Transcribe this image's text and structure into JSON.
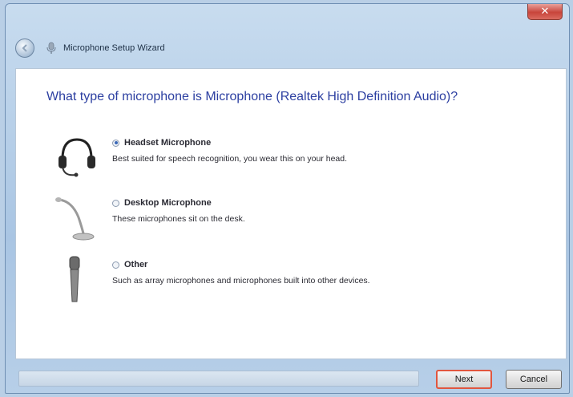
{
  "window": {
    "title": "Microphone Setup Wizard",
    "close_label": "✕"
  },
  "main": {
    "question": "What type of microphone is Microphone (Realtek High Definition Audio)?",
    "options": [
      {
        "label": "Headset Microphone",
        "description": "Best suited for speech recognition, you wear this on your head.",
        "selected": true,
        "icon": "headset-icon"
      },
      {
        "label": "Desktop Microphone",
        "description": "These microphones sit on the desk.",
        "selected": false,
        "icon": "desktop-microphone-icon"
      },
      {
        "label": "Other",
        "description": "Such as array microphones and microphones built into other devices.",
        "selected": false,
        "icon": "handheld-microphone-icon"
      }
    ]
  },
  "footer": {
    "next_label": "Next",
    "cancel_label": "Cancel"
  },
  "colors": {
    "question_text": "#2c3fa1",
    "next_highlight": "#e0563f",
    "close_button": "#c8453b"
  }
}
